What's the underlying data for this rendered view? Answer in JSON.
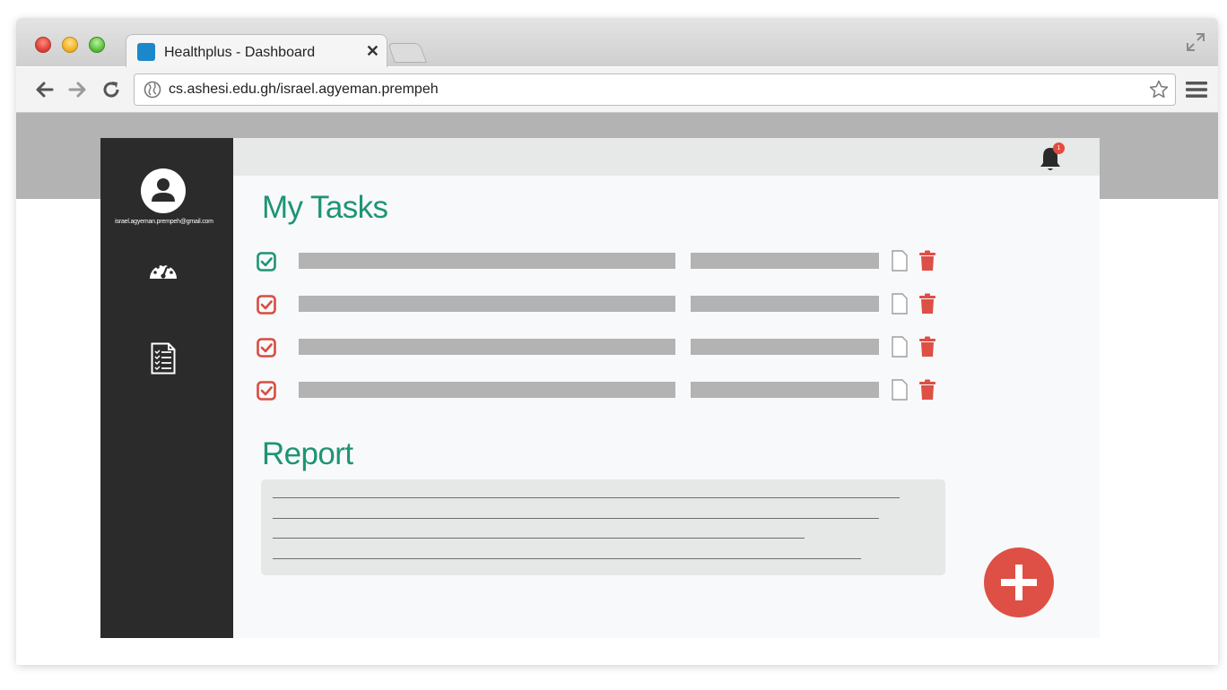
{
  "browser": {
    "tab_title": "Healthplus - Dashboard",
    "tab_close": "✕",
    "url": "cs.ashesi.edu.gh/israel.agyeman.prempeh",
    "favicon_color": "#1c88cc"
  },
  "sidebar": {
    "user_email": "israel.agyeman.prempeh@gmail.com",
    "items": [
      {
        "icon": "dashboard-gauge-icon"
      },
      {
        "icon": "task-list-icon"
      }
    ]
  },
  "header": {
    "notification_icon": "bell-icon",
    "notification_count": "1"
  },
  "tasks": {
    "heading": "My Tasks",
    "rows": [
      {
        "checked": true,
        "check_color": "#1e9475"
      },
      {
        "checked": true,
        "check_color": "#d94c42"
      },
      {
        "checked": true,
        "check_color": "#d94c42"
      },
      {
        "checked": true,
        "check_color": "#d94c42"
      }
    ]
  },
  "report": {
    "heading": "Report"
  },
  "fab": {
    "icon": "plus-icon"
  },
  "colors": {
    "accent": "#1e9475",
    "danger": "#de4f45",
    "sidebar": "#2b2b2b"
  }
}
